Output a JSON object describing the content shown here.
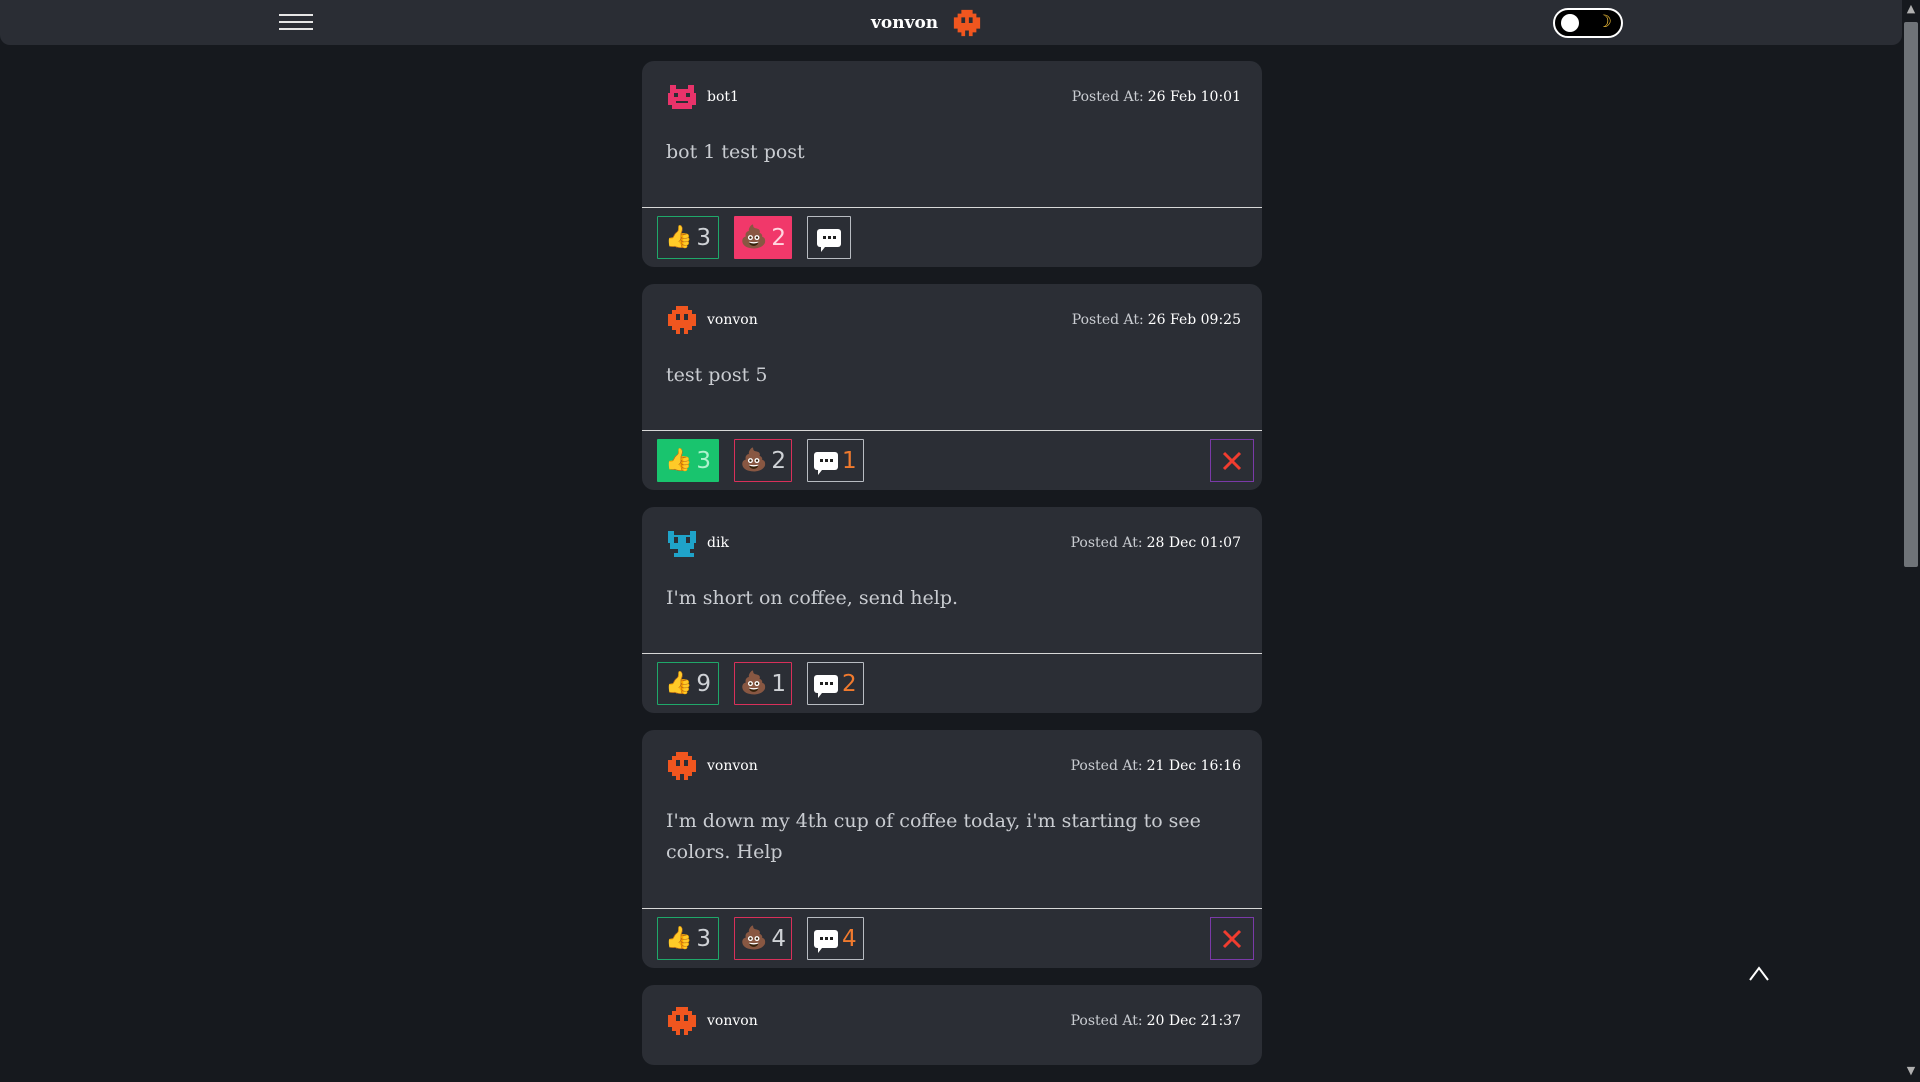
{
  "header": {
    "brand": "vonvon",
    "brand_color": "#f0561f"
  },
  "labels": {
    "posted_at": "Posted At:"
  },
  "posts": [
    {
      "author": "bot1",
      "avatar_color": "#e8336a",
      "timestamp": "26 Feb 10:01",
      "content": "bot 1 test post",
      "likes": "3",
      "poops": "2",
      "comments": "",
      "liked": false,
      "pooped": true,
      "deletable": false
    },
    {
      "author": "vonvon",
      "avatar_color": "#f0561f",
      "timestamp": "26 Feb 09:25",
      "content": "test post 5",
      "likes": "3",
      "poops": "2",
      "comments": "1",
      "liked": true,
      "pooped": false,
      "deletable": true
    },
    {
      "author": "dik",
      "avatar_color": "#1fa3c9",
      "timestamp": "28 Dec 01:07",
      "content": "I'm short on coffee, send help.",
      "likes": "9",
      "poops": "1",
      "comments": "2",
      "liked": false,
      "pooped": false,
      "deletable": false
    },
    {
      "author": "vonvon",
      "avatar_color": "#f0561f",
      "timestamp": "21 Dec 16:16",
      "content": "I'm down my 4th cup of coffee today, i'm starting to see colors. Help",
      "likes": "3",
      "poops": "4",
      "comments": "4",
      "liked": false,
      "pooped": false,
      "deletable": true
    },
    {
      "author": "vonvon",
      "avatar_color": "#f0561f",
      "timestamp": "20 Dec 21:37"
    }
  ]
}
